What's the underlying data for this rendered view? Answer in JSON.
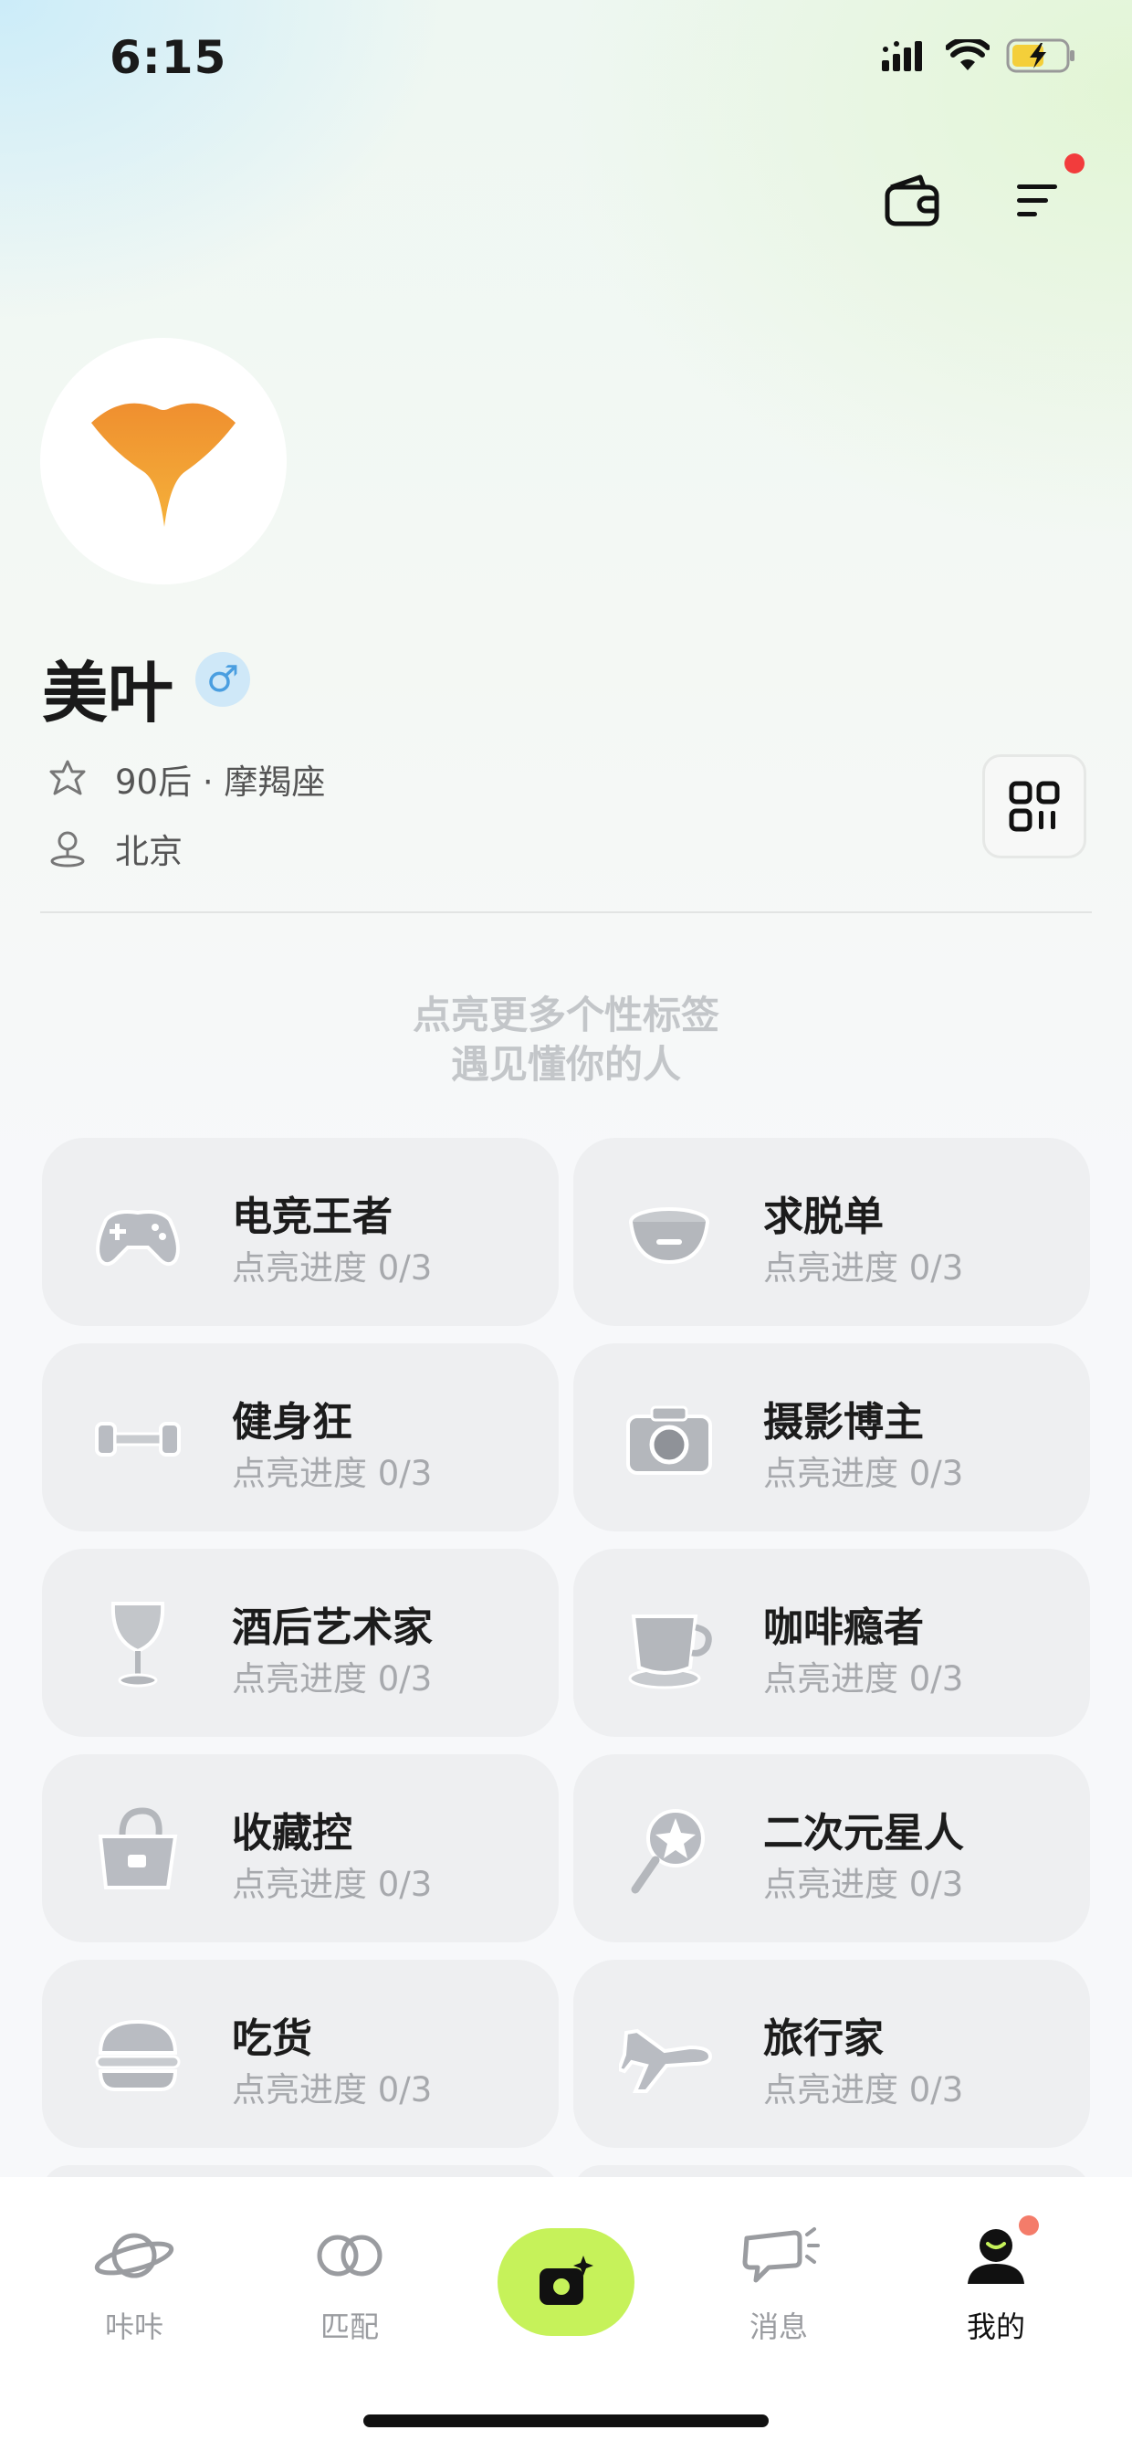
{
  "status_bar": {
    "time": "6:15"
  },
  "header": {
    "wallet_icon": "wallet-icon",
    "menu_icon": "menu-icon",
    "menu_badge_color": "#f23c3c"
  },
  "profile": {
    "name": "美叶",
    "gender_symbol": "♂",
    "birth_info": "90后 · 摩羯座",
    "location": "北京",
    "avatar_icon": "ginkgo-leaf-icon"
  },
  "hint": {
    "line1": "点亮更多个性标签",
    "line2": "遇见懂你的人"
  },
  "tags": [
    {
      "title": "电竞王者",
      "progress": "点亮进度 0/3",
      "icon": "gamepad-icon"
    },
    {
      "title": "求脱单",
      "progress": "点亮进度 0/3",
      "icon": "pet-bowl-icon"
    },
    {
      "title": "健身狂",
      "progress": "点亮进度 0/3",
      "icon": "dumbbell-icon"
    },
    {
      "title": "摄影博主",
      "progress": "点亮进度 0/3",
      "icon": "camera-icon"
    },
    {
      "title": "酒后艺术家",
      "progress": "点亮进度 0/3",
      "icon": "wine-glass-icon"
    },
    {
      "title": "咖啡瘾者",
      "progress": "点亮进度 0/3",
      "icon": "coffee-cup-icon"
    },
    {
      "title": "收藏控",
      "progress": "点亮进度 0/3",
      "icon": "handbag-icon"
    },
    {
      "title": "二次元星人",
      "progress": "点亮进度 0/3",
      "icon": "magic-wand-icon"
    },
    {
      "title": "吃货",
      "progress": "点亮进度 0/3",
      "icon": "burger-icon"
    },
    {
      "title": "旅行家",
      "progress": "点亮进度 0/3",
      "icon": "airplane-icon"
    }
  ],
  "nav": {
    "items": [
      {
        "label": "咔咔",
        "icon": "planet-icon"
      },
      {
        "label": "匹配",
        "icon": "rings-icon"
      },
      {
        "label": "",
        "icon": "camera-sparkle-icon"
      },
      {
        "label": "消息",
        "icon": "chat-bubble-icon"
      },
      {
        "label": "我的",
        "icon": "profile-icon"
      }
    ],
    "accent_color": "#c6f25a"
  }
}
